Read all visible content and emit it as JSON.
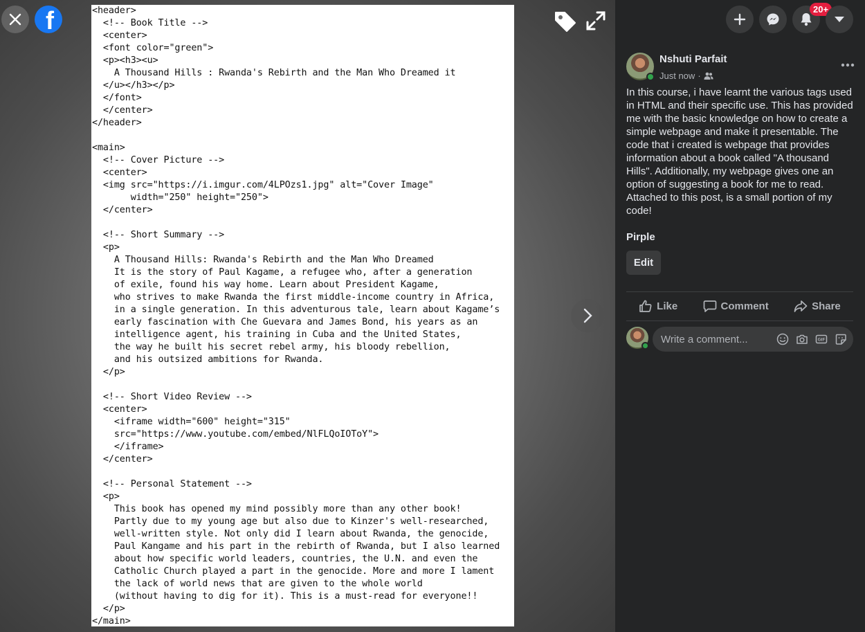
{
  "viewer": {
    "close_icon": "close-icon",
    "logo_letter": "f",
    "code_lines": [
      "<header>",
      "  <!-- Book Title -->",
      "  <center>",
      "  <font color=\"green\">",
      "  <p><h3><u>",
      "    A Thousand Hills : Rwanda's Rebirth and the Man Who Dreamed it",
      "  </u></h3></p>",
      "  </font>",
      "  </center>",
      "</header>",
      "",
      "<main>",
      "  <!-- Cover Picture -->",
      "  <center>",
      "  <img src=\"https://i.imgur.com/4LPOzs1.jpg\" alt=\"Cover Image\"",
      "       width=\"250\" height=\"250\">",
      "  </center>",
      "",
      "  <!-- Short Summary -->",
      "  <p>",
      "    A Thousand Hills: Rwanda's Rebirth and the Man Who Dreamed",
      "    It is the story of Paul Kagame, a refugee who, after a generation",
      "    of exile, found his way home. Learn about President Kagame,",
      "    who strives to make Rwanda the first middle-income country in Africa,",
      "    in a single generation. In this adventurous tale, learn about Kagame’s",
      "    early fascination with Che Guevara and James Bond, his years as an",
      "    intelligence agent, his training in Cuba and the United States,",
      "    the way he built his secret rebel army, his bloody rebellion,",
      "    and his outsized ambitions for Rwanda.",
      "  </p>",
      "",
      "  <!-- Short Video Review -->",
      "  <center>",
      "    <iframe width=\"600\" height=\"315\"",
      "    src=\"https://www.youtube.com/embed/NlFLQoIOToY\">",
      "    </iframe>",
      "  </center>",
      "",
      "  <!-- Personal Statement -->",
      "  <p>",
      "    This book has opened my mind possibly more than any other book!",
      "    Partly due to my young age but also due to Kinzer's well-researched,",
      "    well-written style. Not only did I learn about Rwanda, the genocide,",
      "    Paul Kangame and his part in the rebirth of Rwanda, but I also learned",
      "    about how specific world leaders, countries, the U.N. and even the",
      "    Catholic Church played a part in the genocide. More and more I lament",
      "    the lack of world news that are given to the whole world",
      "    (without having to dig for it). This is a must-read for everyone!!",
      "  </p>",
      "</main>"
    ]
  },
  "topbar": {
    "notification_count": "20+"
  },
  "post": {
    "author": "Nshuti Parfait",
    "time": "Just now",
    "audience_icon": "friends-icon",
    "text": "In this course, i have learnt the various tags used in HTML and their specific use. This has provided me with the basic knowledge on how to create a simple webpage and make it presentable. The code that i created is webpage that provides information about a book called \"A thousand Hills\". Additionally, my webpage gives one an option of suggesting a book for me to read. Attached to this post, is a small portion of my code!",
    "tagged": "Pirple",
    "edit_label": "Edit"
  },
  "actions": {
    "like": "Like",
    "comment": "Comment",
    "share": "Share"
  },
  "comment_box": {
    "placeholder": "Write a comment..."
  },
  "colors": {
    "accent": "#1877f2",
    "badge": "#e41e3f",
    "online": "#31a24c",
    "panel_bg": "#242526"
  }
}
